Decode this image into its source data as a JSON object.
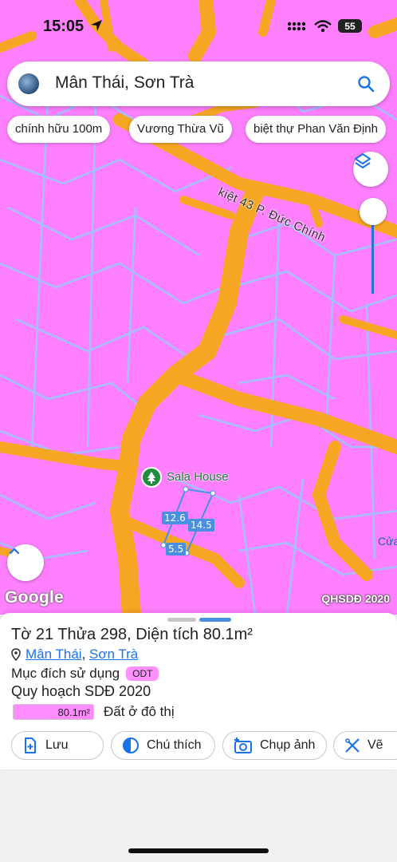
{
  "status": {
    "time": "15:05",
    "battery": "55"
  },
  "search": {
    "query": "Mân Thái, Sơn Trà"
  },
  "chips": [
    "chính hữu 100m",
    "Vương Thừa Vũ",
    "biệt thự Phan Văn Định"
  ],
  "map": {
    "street_label": "kiệt 43 P. Đức Chính",
    "poi_label": "Sala House",
    "edge_label": "Cửa",
    "attribution": "Google",
    "layer_name": "QHSDĐ 2020",
    "dimensions": [
      "12.6",
      "14.5",
      "5.5"
    ]
  },
  "sheet": {
    "title": "Tờ 21 Thửa 298, Diện tích 80.1m²",
    "location_ward": "Mân Thái",
    "location_sep": ",",
    "location_district": "Sơn Trà",
    "purpose_label": "Mục đích sử dụng",
    "purpose_code": "ODT",
    "plan_title": "Quy hoạch SDĐ 2020",
    "legend_area": "80.1m²",
    "legend_text": "Đất ở đô thị"
  },
  "actions": {
    "save": "Lưu",
    "legend": "Chú thích",
    "photo": "Chụp ảnh",
    "draw": "Vẽ"
  },
  "colors": {
    "land": "#ff7fff",
    "road": "#f5a623",
    "parcel_line": "#a9c8ff",
    "accent": "#1a73e8"
  }
}
